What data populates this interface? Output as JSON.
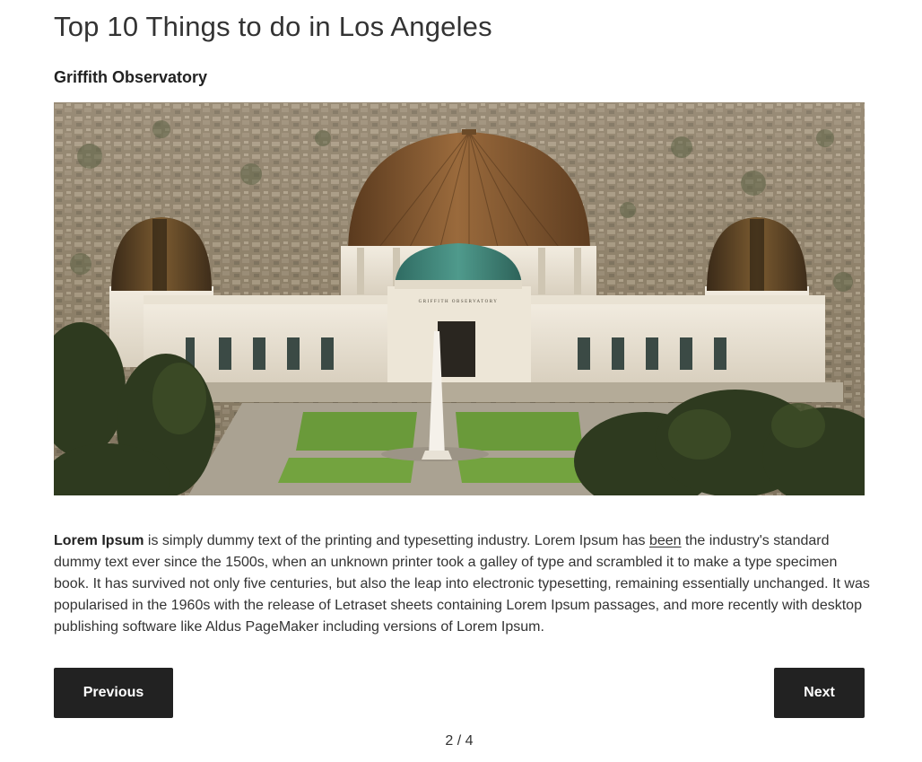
{
  "page": {
    "title": "Top 10 Things to do in Los Angeles"
  },
  "item": {
    "heading": "Griffith Observatory",
    "image_alt": "Griffith Observatory",
    "building_sign": "GRIFFITH OBSERVATORY",
    "description": {
      "lead": "Lorem Ipsum",
      "part1": " is simply dummy text of the printing and typesetting industry. Lorem Ipsum has ",
      "link": "been",
      "part2": " the industry's standard dummy text ever since the 1500s, when an unknown printer took a galley of type and scrambled it to make a type specimen book. It has survived not only five centuries, but also the leap into electronic typesetting, remaining essentially unchanged. It was popularised in the 1960s with the release of Letraset sheets containing Lorem Ipsum passages, and more recently with desktop publishing software like Aldus PageMaker including versions of Lorem Ipsum."
    }
  },
  "navigation": {
    "previous_label": "Previous",
    "next_label": "Next",
    "pager": "2 / 4"
  },
  "colors": {
    "button_bg": "#222222",
    "button_text": "#ffffff",
    "text": "#333333"
  }
}
